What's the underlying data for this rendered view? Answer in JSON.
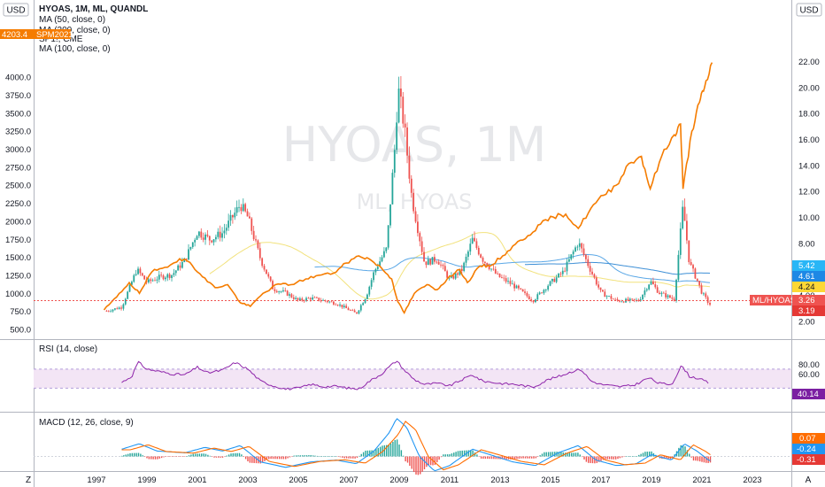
{
  "header": {
    "symbol": "HYOAS, 1M, ML, QUANDL",
    "ma1": "MA (50, close, 0)",
    "ma2": "MA (200, close, 0)",
    "compare": "SP1!, CME",
    "ma3": "MA (100, close, 0)",
    "left_currency": "USD",
    "right_currency": "USD",
    "watermark_main": "HYOAS, 1M",
    "watermark_sub": "ML, HYOAS"
  },
  "tags": {
    "sp_value": "4203.4",
    "sp_name": "SPM2021",
    "ml_name": "ML/HYOAS",
    "ml_value": "3.26",
    "ma_a": "5.42",
    "ma_b": "4.61",
    "ma_c": "4.24",
    "ml_low": "3.19",
    "rsi_value": "40.14",
    "macd_a": "0.07",
    "macd_b": "-0.24",
    "macd_c": "-0.31"
  },
  "panes": {
    "rsi_title": "RSI (14, close)",
    "macd_title": "MACD (12, 26, close, 9)"
  },
  "footer": {
    "left_btn": "Z",
    "right_btn": "A"
  },
  "colors": {
    "up": "#26a69a",
    "down": "#ef5350",
    "sp": "#f57c00",
    "ma_yellow": "#f2e27d",
    "ma_blue": "#5aa7e6",
    "rsi": "#8e24aa",
    "rsi_band": "#f3e5f5",
    "macd": "#2196f3",
    "signal": "#ff6d00",
    "hline": "#ef5350"
  },
  "chart_data": [
    {
      "type": "candlestick",
      "series_name": "HYOAS",
      "axis_left_ticks": [
        "500.0",
        "750.0",
        "1000.0",
        "1250.0",
        "1500.0",
        "1750.0",
        "2000.0",
        "2250.0",
        "2500.0",
        "2750.0",
        "3000.0",
        "3250.0",
        "3500.0",
        "3750.0",
        "4000.0"
      ],
      "axis_right_ticks": [
        "2.00",
        "4.00",
        "6.00",
        "8.00",
        "10.00",
        "12.00",
        "14.00",
        "16.00",
        "18.00",
        "20.00",
        "22.00"
      ],
      "x_ticks": [
        "1997",
        "1999",
        "2001",
        "2003",
        "2005",
        "2007",
        "2009",
        "2011",
        "2013",
        "2015",
        "2017",
        "2019",
        "2021",
        "2023"
      ],
      "ylim_right": [
        1.3,
        22.6
      ],
      "ylim_left": [
        430,
        4200
      ],
      "hyoas_key_points": [
        [
          1997.4,
          2.8
        ],
        [
          1998.0,
          3.1
        ],
        [
          1998.6,
          6.0
        ],
        [
          1999.0,
          5.0
        ],
        [
          1999.5,
          5.4
        ],
        [
          2000.0,
          5.6
        ],
        [
          2000.5,
          6.7
        ],
        [
          2001.0,
          8.9
        ],
        [
          2001.5,
          8.3
        ],
        [
          2002.0,
          8.8
        ],
        [
          2002.7,
          11.0
        ],
        [
          2003.0,
          10.0
        ],
        [
          2003.5,
          6.8
        ],
        [
          2004.0,
          4.5
        ],
        [
          2004.5,
          4.2
        ],
        [
          2005.0,
          3.6
        ],
        [
          2005.5,
          3.8
        ],
        [
          2006.0,
          3.6
        ],
        [
          2006.5,
          3.4
        ],
        [
          2007.3,
          2.6
        ],
        [
          2007.7,
          4.0
        ],
        [
          2008.0,
          5.8
        ],
        [
          2008.5,
          7.6
        ],
        [
          2008.85,
          16.0
        ],
        [
          2008.95,
          20.0
        ],
        [
          2009.2,
          17.0
        ],
        [
          2009.5,
          11.5
        ],
        [
          2010.0,
          6.5
        ],
        [
          2010.5,
          6.8
        ],
        [
          2011.0,
          5.2
        ],
        [
          2011.5,
          6.0
        ],
        [
          2011.9,
          8.3
        ],
        [
          2012.3,
          6.8
        ],
        [
          2012.9,
          5.5
        ],
        [
          2013.5,
          4.8
        ],
        [
          2014.3,
          3.6
        ],
        [
          2014.9,
          4.8
        ],
        [
          2015.5,
          5.8
        ],
        [
          2016.1,
          8.1
        ],
        [
          2016.5,
          6.3
        ],
        [
          2017.0,
          4.2
        ],
        [
          2017.6,
          3.6
        ],
        [
          2018.5,
          3.6
        ],
        [
          2018.95,
          5.1
        ],
        [
          2019.3,
          4.2
        ],
        [
          2019.9,
          3.7
        ],
        [
          2020.25,
          10.9
        ],
        [
          2020.5,
          6.5
        ],
        [
          2020.8,
          5.2
        ],
        [
          2021.0,
          4.2
        ],
        [
          2021.3,
          3.3
        ]
      ]
    },
    {
      "type": "line",
      "series_name": "SPM2021",
      "sp_key_points": [
        [
          1997.3,
          770
        ],
        [
          1997.8,
          950
        ],
        [
          1998.3,
          1150
        ],
        [
          1998.7,
          1000
        ],
        [
          1999.2,
          1300
        ],
        [
          1999.7,
          1360
        ],
        [
          2000.3,
          1480
        ],
        [
          2000.7,
          1430
        ],
        [
          2001.2,
          1230
        ],
        [
          2001.7,
          1080
        ],
        [
          2002.2,
          1120
        ],
        [
          2002.7,
          870
        ],
        [
          2003.1,
          820
        ],
        [
          2003.6,
          1000
        ],
        [
          2004.2,
          1130
        ],
        [
          2004.7,
          1120
        ],
        [
          2005.3,
          1200
        ],
        [
          2005.8,
          1250
        ],
        [
          2006.4,
          1280
        ],
        [
          2006.9,
          1420
        ],
        [
          2007.4,
          1520
        ],
        [
          2007.8,
          1480
        ],
        [
          2008.3,
          1350
        ],
        [
          2008.7,
          1200
        ],
        [
          2008.95,
          880
        ],
        [
          2009.2,
          730
        ],
        [
          2009.6,
          1000
        ],
        [
          2010.1,
          1120
        ],
        [
          2010.5,
          1050
        ],
        [
          2010.9,
          1200
        ],
        [
          2011.4,
          1330
        ],
        [
          2011.7,
          1150
        ],
        [
          2012.2,
          1380
        ],
        [
          2012.6,
          1380
        ],
        [
          2013.1,
          1520
        ],
        [
          2013.6,
          1680
        ],
        [
          2014.1,
          1800
        ],
        [
          2014.6,
          1960
        ],
        [
          2015.1,
          2060
        ],
        [
          2015.6,
          2100
        ],
        [
          2016.1,
          1900
        ],
        [
          2016.6,
          2180
        ],
        [
          2017.1,
          2360
        ],
        [
          2017.6,
          2500
        ],
        [
          2018.1,
          2800
        ],
        [
          2018.6,
          2900
        ],
        [
          2018.95,
          2450
        ],
        [
          2019.4,
          2900
        ],
        [
          2019.9,
          3200
        ],
        [
          2020.15,
          3350
        ],
        [
          2020.25,
          2450
        ],
        [
          2020.6,
          3250
        ],
        [
          2020.9,
          3650
        ],
        [
          2021.1,
          3850
        ],
        [
          2021.4,
          4203
        ]
      ]
    },
    {
      "type": "line",
      "series_name": "RSI (14, close)",
      "levels": [
        30,
        70
      ],
      "rsi_key_points": [
        [
          1998.0,
          42
        ],
        [
          1998.4,
          55
        ],
        [
          1998.65,
          85
        ],
        [
          1999.0,
          70
        ],
        [
          1999.5,
          65
        ],
        [
          2000.0,
          60
        ],
        [
          2000.5,
          58
        ],
        [
          2001.0,
          74
        ],
        [
          2001.4,
          62
        ],
        [
          2002.0,
          68
        ],
        [
          2002.5,
          84
        ],
        [
          2003.0,
          70
        ],
        [
          2003.5,
          45
        ],
        [
          2004.0,
          35
        ],
        [
          2004.5,
          28
        ],
        [
          2005.0,
          30
        ],
        [
          2005.5,
          38
        ],
        [
          2006.0,
          33
        ],
        [
          2006.5,
          34
        ],
        [
          2007.0,
          30
        ],
        [
          2007.4,
          28
        ],
        [
          2007.8,
          44
        ],
        [
          2008.3,
          60
        ],
        [
          2008.65,
          77
        ],
        [
          2008.9,
          88
        ],
        [
          2009.2,
          68
        ],
        [
          2009.6,
          48
        ],
        [
          2010.0,
          38
        ],
        [
          2010.5,
          40
        ],
        [
          2011.0,
          35
        ],
        [
          2011.5,
          48
        ],
        [
          2011.9,
          58
        ],
        [
          2012.3,
          45
        ],
        [
          2013.0,
          40
        ],
        [
          2013.6,
          38
        ],
        [
          2014.3,
          32
        ],
        [
          2014.9,
          48
        ],
        [
          2015.4,
          56
        ],
        [
          2015.9,
          66
        ],
        [
          2016.2,
          70
        ],
        [
          2016.6,
          45
        ],
        [
          2017.0,
          38
        ],
        [
          2017.7,
          33
        ],
        [
          2018.3,
          36
        ],
        [
          2018.9,
          52
        ],
        [
          2019.3,
          40
        ],
        [
          2019.8,
          38
        ],
        [
          2020.2,
          78
        ],
        [
          2020.5,
          55
        ],
        [
          2020.9,
          50
        ],
        [
          2021.3,
          40
        ]
      ]
    },
    {
      "type": "line",
      "series_name": "MACD (12, 26, close, 9)",
      "macd_key_points": [
        [
          1998.0,
          0.4
        ],
        [
          1998.7,
          0.7
        ],
        [
          1999.4,
          0.3
        ],
        [
          2000.5,
          0.2
        ],
        [
          2001.3,
          0.5
        ],
        [
          2002.0,
          0.3
        ],
        [
          2002.7,
          0.6
        ],
        [
          2003.5,
          -0.3
        ],
        [
          2004.5,
          -0.6
        ],
        [
          2005.5,
          -0.3
        ],
        [
          2006.5,
          -0.2
        ],
        [
          2007.3,
          -0.4
        ],
        [
          2008.0,
          0.3
        ],
        [
          2008.6,
          1.3
        ],
        [
          2008.9,
          2.1
        ],
        [
          2009.3,
          1.6
        ],
        [
          2009.8,
          0.0
        ],
        [
          2010.4,
          -0.8
        ],
        [
          2011.0,
          -0.5
        ],
        [
          2011.9,
          0.4
        ],
        [
          2012.6,
          0.1
        ],
        [
          2013.5,
          -0.3
        ],
        [
          2014.4,
          -0.5
        ],
        [
          2015.3,
          0.2
        ],
        [
          2016.1,
          0.6
        ],
        [
          2016.8,
          -0.2
        ],
        [
          2017.6,
          -0.5
        ],
        [
          2018.4,
          -0.4
        ],
        [
          2019.0,
          0.1
        ],
        [
          2019.8,
          -0.2
        ],
        [
          2020.3,
          0.7
        ],
        [
          2020.8,
          0.3
        ],
        [
          2021.3,
          -0.24
        ]
      ]
    }
  ]
}
